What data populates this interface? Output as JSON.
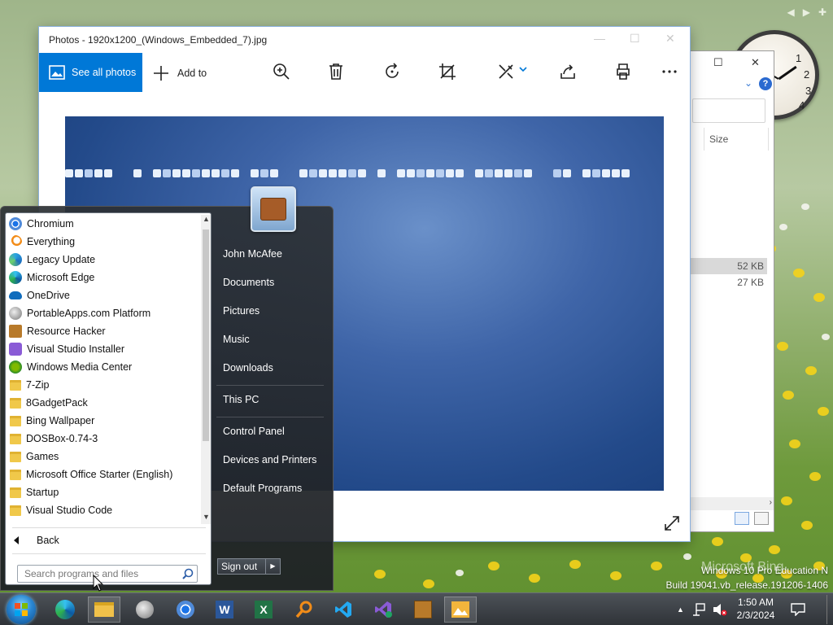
{
  "photos": {
    "title": "Photos - 1920x1200_(Windows_Embedded_7).jpg",
    "see_all": "See all photos",
    "add_to": "Add to"
  },
  "explorer": {
    "col_size": "Size",
    "row1_size": "52 KB",
    "row2_size": "27 KB"
  },
  "start_menu": {
    "programs": [
      {
        "label": "Chromium",
        "icon": "chromium-icon"
      },
      {
        "label": "Everything",
        "icon": "everything-icon"
      },
      {
        "label": "Legacy Update",
        "icon": "legacy-update-icon"
      },
      {
        "label": "Microsoft Edge",
        "icon": "edge-icon"
      },
      {
        "label": "OneDrive",
        "icon": "onedrive-icon"
      },
      {
        "label": "PortableApps.com Platform",
        "icon": "portableapps-icon"
      },
      {
        "label": "Resource Hacker",
        "icon": "resource-hacker-icon"
      },
      {
        "label": "Visual Studio Installer",
        "icon": "vs-installer-icon"
      },
      {
        "label": "Windows Media Center",
        "icon": "media-center-icon"
      },
      {
        "label": "7-Zip",
        "icon": "folder-icon"
      },
      {
        "label": "8GadgetPack",
        "icon": "folder-icon"
      },
      {
        "label": "Bing Wallpaper",
        "icon": "folder-icon"
      },
      {
        "label": "DOSBox-0.74-3",
        "icon": "folder-icon"
      },
      {
        "label": "Games",
        "icon": "folder-icon"
      },
      {
        "label": "Microsoft Office Starter (English)",
        "icon": "folder-icon"
      },
      {
        "label": "Startup",
        "icon": "folder-icon"
      },
      {
        "label": "Visual Studio Code",
        "icon": "folder-icon"
      }
    ],
    "back": "Back",
    "search_placeholder": "Search programs and files",
    "user": "John McAfee",
    "links": {
      "documents": "Documents",
      "pictures": "Pictures",
      "music": "Music",
      "downloads": "Downloads",
      "this_pc": "This PC",
      "control_panel": "Control Panel",
      "devices": "Devices and Printers",
      "default_programs": "Default Programs"
    },
    "sign_out": "Sign out"
  },
  "watermark": {
    "line1": "Windows 10 Pro Education N",
    "line2": "Build 19041.vb_release.191206-1406",
    "bing": "Microsoft Bing"
  },
  "taskbar": {
    "time": "1:50 AM",
    "date": "2/3/2024"
  },
  "colors": {
    "accent": "#0078d7"
  }
}
